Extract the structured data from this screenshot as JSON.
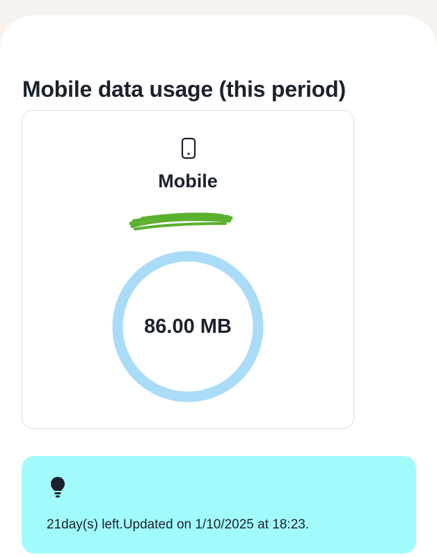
{
  "page": {
    "title": "Mobile data usage (this period)"
  },
  "usage_card": {
    "icon": "phone-icon",
    "line_label": "Mobile",
    "redacted_number": "",
    "usage_value": "86.00 MB",
    "ring_color": "#aadcf8"
  },
  "info": {
    "icon": "lightbulb-icon",
    "text": "21day(s) left.Updated on 1/10/2025 at 18:23.",
    "background": "#a1fbfb"
  },
  "colors": {
    "redaction_scribble": "#5bb02e"
  }
}
